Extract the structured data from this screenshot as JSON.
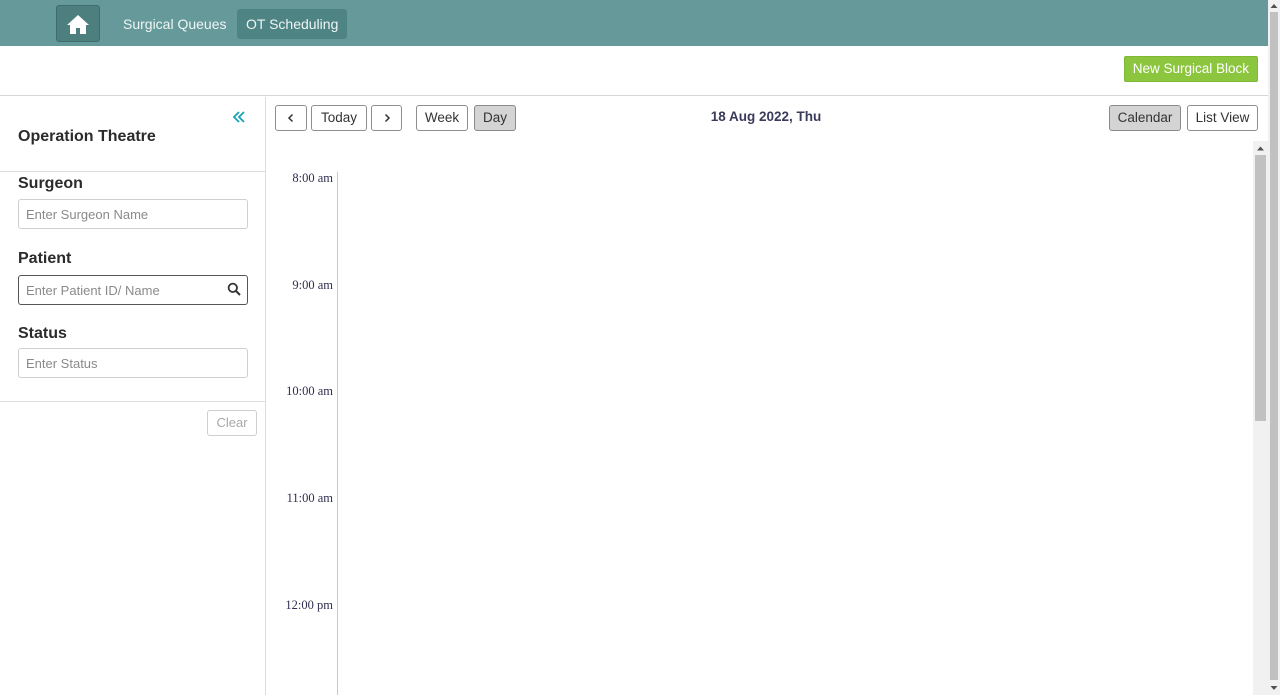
{
  "nav": {
    "home_icon": "home-icon",
    "links": [
      {
        "label": "Surgical Queues",
        "active": false
      },
      {
        "label": "OT Scheduling",
        "active": true
      }
    ],
    "bar_color": "#669999"
  },
  "header": {
    "new_block_label": "New Surgical Block",
    "accent_color": "#8cc63f"
  },
  "sidebar": {
    "collapse_icon": "double-chevron-left-icon",
    "title": "Operation Theatre",
    "surgeon": {
      "label": "Surgeon",
      "placeholder": "Enter Surgeon Name",
      "value": ""
    },
    "patient": {
      "label": "Patient",
      "placeholder": "Enter Patient ID/ Name",
      "value": "",
      "icon": "search-icon"
    },
    "status": {
      "label": "Status",
      "placeholder": "Enter Status",
      "value": ""
    },
    "clear_label": "Clear"
  },
  "toolbar": {
    "prev_icon": "chevron-left-icon",
    "today_label": "Today",
    "next_icon": "chevron-right-icon",
    "week_label": "Week",
    "day_label": "Day",
    "active_range": "Day",
    "date_title": "18 Aug 2022, Thu",
    "calendar_label": "Calendar",
    "list_view_label": "List View",
    "active_view": "Calendar"
  },
  "calendar": {
    "time_slots": [
      "8:00 am",
      "9:00 am",
      "10:00 am",
      "11:00 am",
      "12:00 pm"
    ]
  }
}
